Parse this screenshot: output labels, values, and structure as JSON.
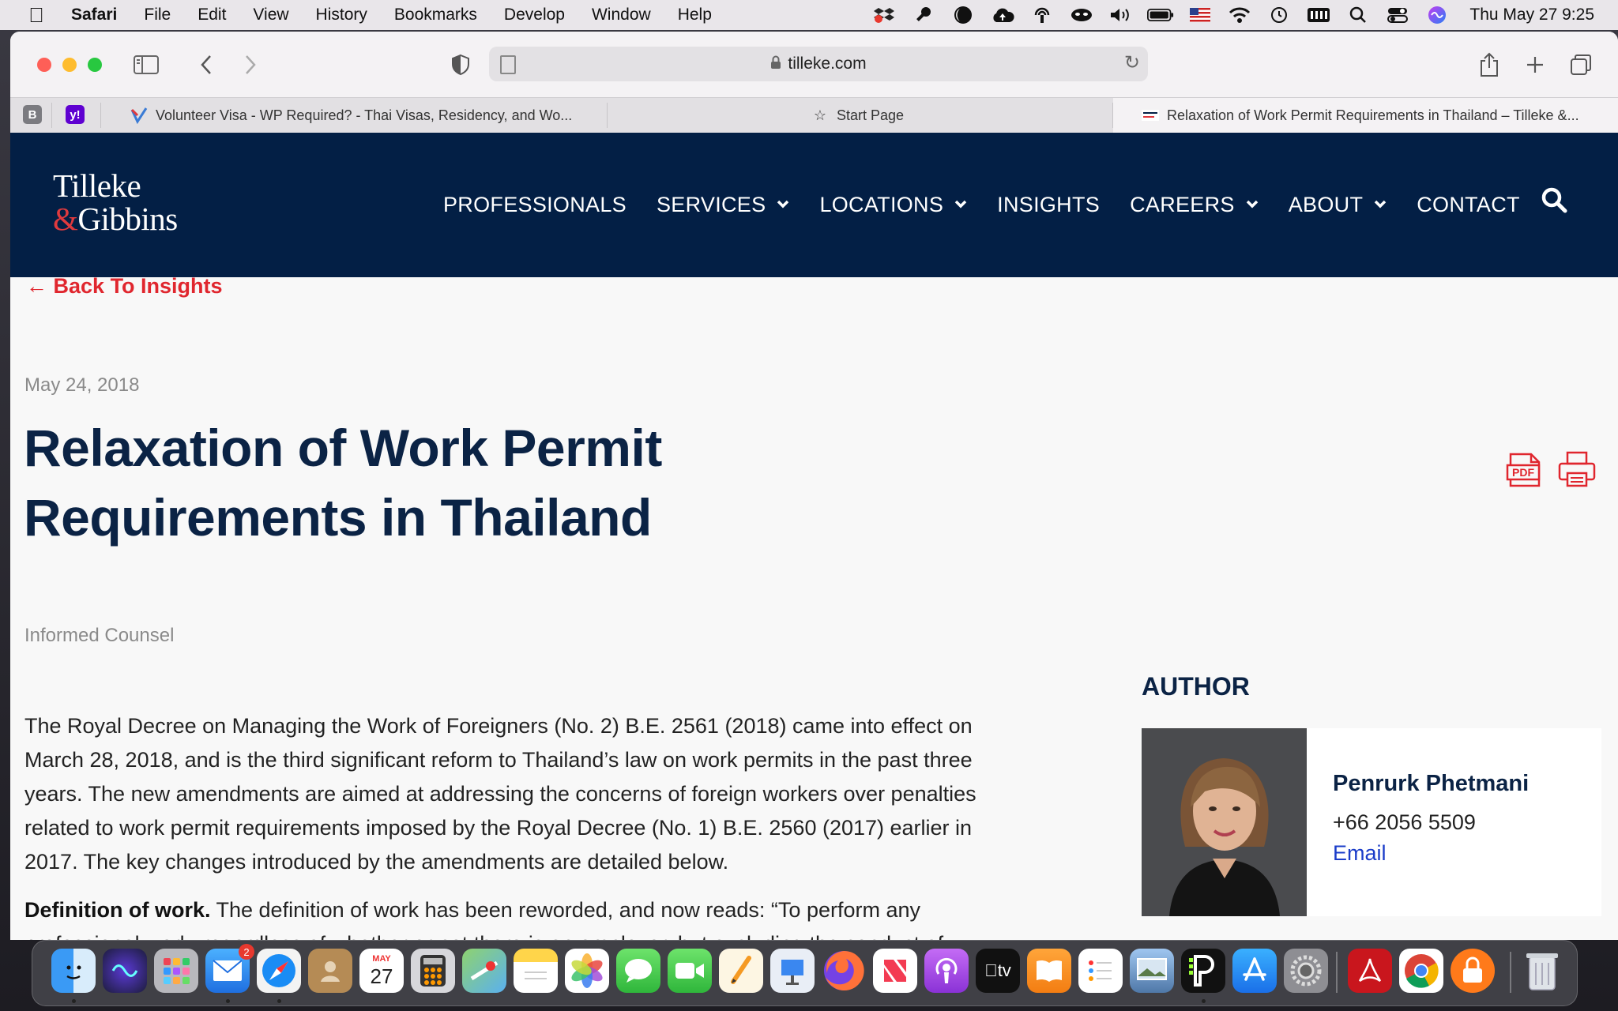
{
  "menubar": {
    "app": "Safari",
    "items": [
      "File",
      "Edit",
      "View",
      "History",
      "Bookmarks",
      "Develop",
      "Window",
      "Help"
    ],
    "clock": "Thu May 27  9:25"
  },
  "browser": {
    "url": "tilleke.com",
    "tabs": {
      "pinned_1": "B",
      "pinned_2": "y!",
      "tab1": "Volunteer Visa - WP Required? - Thai Visas, Residency, and Wo...",
      "tab2": "Start Page",
      "tab3": "Relaxation of Work Permit Requirements in Thailand – Tilleke &..."
    }
  },
  "site": {
    "logo_line1": "Tilleke",
    "logo_amp": "&",
    "logo_line2": "Gibbins",
    "nav": {
      "professionals": "PROFESSIONALS",
      "services": "SERVICES",
      "locations": "LOCATIONS",
      "insights": "INSIGHTS",
      "careers": "CAREERS",
      "about": "ABOUT",
      "contact": "CONTACT"
    }
  },
  "article": {
    "back": "Back To Insights",
    "date": "May 24, 2018",
    "title": "Relaxation of Work Permit Requirements in Thailand",
    "subtitle": "Informed Counsel",
    "para1": "The Royal Decree on Managing the Work of Foreigners (No. 2) B.E. 2561 (2018) came into effect on March 28, 2018, and is the third significant reform to Thailand’s law on work permits in the past three years. The new amendments are aimed at addressing the concerns of foreign workers over penalties related to work permit requirements imposed by the Royal Decree (No. 1) B.E. 2560 (2017) earlier in 2017. The key changes introduced by the amendments are detailed below.",
    "para2_bold": "Definition of work.",
    "para2": " The definition of work has been reworded, and now reads: “To perform any professional work, regardless of whether or not there is an employer, but excluding the conduct of",
    "pdf_label": "PDF"
  },
  "author": {
    "heading": "AUTHOR",
    "name": "Penrurk Phetmani",
    "phone": "+66 2056 5509",
    "email": "Email"
  },
  "dock": {
    "mail_badge": "2",
    "calendar_month": "MAY",
    "calendar_day": "27",
    "tv_label": "tv"
  },
  "colors": {
    "brand_navy": "#031f45",
    "accent_red": "#e0262e",
    "link_blue": "#1a3cc9"
  }
}
